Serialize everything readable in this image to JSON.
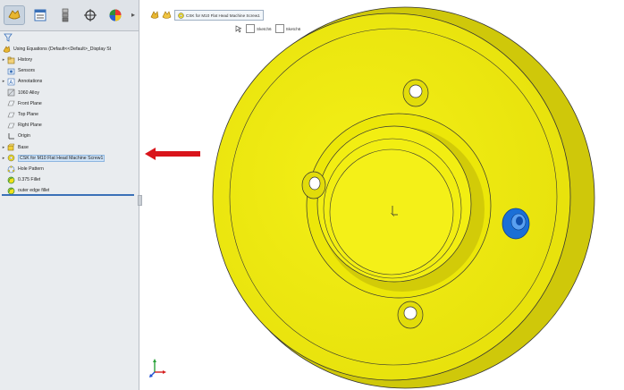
{
  "feature_manager": {
    "tabs": [
      {
        "name": "featuremanager-tab",
        "icon": "part-feature-icon",
        "active": true
      },
      {
        "name": "propertymanager-tab",
        "icon": "property-list-icon",
        "active": false
      },
      {
        "name": "configurationmanager-tab",
        "icon": "configuration-icon",
        "active": false
      },
      {
        "name": "dimxpert-tab",
        "icon": "crosshair-icon",
        "active": false
      },
      {
        "name": "display-manager-tab",
        "icon": "appearance-sphere-icon",
        "active": false
      }
    ],
    "root_label": "Using Equations  (Default<<Default>_Display St",
    "items": [
      {
        "label": "History",
        "icon": "history-folder-icon",
        "expander": "▸"
      },
      {
        "label": "Sensors",
        "icon": "sensors-folder-icon",
        "expander": ""
      },
      {
        "label": "Annotations",
        "icon": "annotations-icon",
        "expander": "▸"
      },
      {
        "label": "1060 Alloy",
        "icon": "material-icon",
        "expander": ""
      },
      {
        "label": "Front Plane",
        "icon": "plane-icon",
        "expander": ""
      },
      {
        "label": "Top Plane",
        "icon": "plane-icon",
        "expander": ""
      },
      {
        "label": "Right Plane",
        "icon": "plane-icon",
        "expander": ""
      },
      {
        "label": "Origin",
        "icon": "origin-icon",
        "expander": ""
      },
      {
        "label": "Base",
        "icon": "extrude-feature-icon",
        "expander": "▸"
      },
      {
        "label": "CSK for M10 Flat Head Machine Screw1",
        "icon": "hole-wizard-icon",
        "expander": "▸",
        "selected": true
      },
      {
        "label": "Hole Pattern",
        "icon": "circular-pattern-icon",
        "expander": ""
      },
      {
        "label": "0.375 Fillet",
        "icon": "fillet-icon",
        "expander": ""
      },
      {
        "label": "outer edge fillet",
        "icon": "fillet-icon",
        "expander": ""
      }
    ]
  },
  "breadcrumb": {
    "label": "CSK for M10 Flat Head Machine Screw1"
  },
  "sketches": [
    {
      "label": "Sketch6"
    },
    {
      "label": "Sketch6"
    }
  ],
  "colors": {
    "part_yellow": "#f2ee10",
    "highlight_blue": "#1b6fd6",
    "arrow_red": "#d9141b"
  }
}
